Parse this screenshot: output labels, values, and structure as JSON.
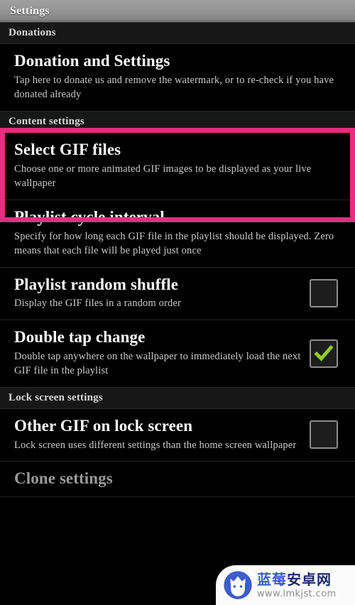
{
  "titlebar": {
    "title": "Settings"
  },
  "sections": [
    {
      "header": "Donations"
    },
    {
      "header": "Content settings"
    },
    {
      "header": "Lock screen settings"
    }
  ],
  "rows": {
    "donation": {
      "title": "Donation and Settings",
      "subtitle": "Tap here to donate us and remove the watermark, or to re-check if you have donated already"
    },
    "select_gif": {
      "title": "Select GIF files",
      "subtitle": "Choose one or more animated GIF images to be displayed as your live wallpaper"
    },
    "cycle_interval": {
      "title": "Playlist cycle interval",
      "subtitle": "Specify for how long each GIF file in the playlist should be displayed. Zero means that each file will be played just once"
    },
    "random_shuffle": {
      "title": "Playlist random shuffle",
      "subtitle": "Display the GIF files in a random order",
      "checked": false
    },
    "double_tap": {
      "title": "Double tap change",
      "subtitle": "Double tap anywhere on the wallpaper to immediately load the next GIF file in the playlist",
      "checked": true
    },
    "other_gif_lock": {
      "title": "Other GIF on lock screen",
      "subtitle": "Lock screen uses different settings than the home screen wallpaper",
      "checked": false
    },
    "clone_settings": {
      "title": "Clone settings"
    }
  },
  "highlight": {
    "color": "#e52e80"
  },
  "watermark": {
    "cn_first": "蓝莓",
    "cn_second": "安卓网",
    "url": "www.lmkjst.com",
    "logo_color": "#3d5ccc"
  },
  "colors": {
    "check_green": "#8fce2b",
    "background": "#000000",
    "section_header_bg": "#171717"
  }
}
